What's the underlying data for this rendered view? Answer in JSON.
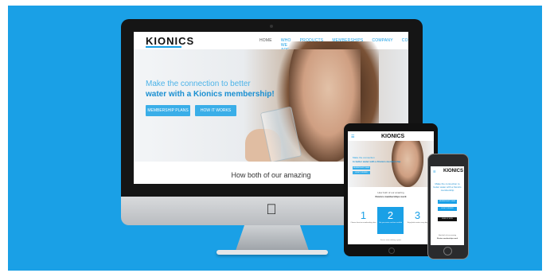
{
  "colors": {
    "background": "#1aa0e6",
    "accent": "#3aaee8",
    "headline_dark": "#1a8fd1"
  },
  "site": {
    "logo": "KIONICS",
    "nav": [
      "HOME",
      "WHO WE ARE",
      "PRODUCTS",
      "MEMBERSHIPS",
      "COMPANY",
      "CONTACT"
    ],
    "hero_line1": "Make the connection to better",
    "hero_line2": "water with a Kionics membership!",
    "btn_plans": "MEMBERSHIP PLANS",
    "btn_how": "HOW IT WORKS",
    "sub_heading": "How both of our amazing"
  },
  "tablet": {
    "logo": "KIONICS",
    "menu_icon": "hamburger-icon",
    "hero_line1": "Make the connection",
    "hero_line2": "to better water with a Kionics membership",
    "btn_plans": "MEMBERSHIP PLANS",
    "btn_how": "HOW IT WORKS",
    "sub1": "How both of our amazing",
    "sub2": "Kionics memberships work",
    "steps": [
      {
        "num": "1",
        "desc": "Choose from two membership plans"
      },
      {
        "num": "2",
        "desc": "Get your water machine installed"
      },
      {
        "num": "3",
        "desc": "Enjoy better water every day"
      }
    ],
    "footer": "Kionics water drinking system"
  },
  "phone": {
    "logo": "KIONICS",
    "menu_icon": "hamburger-icon",
    "hero": "Make the connection to better water with a Kionics membership",
    "btn1": "MEMBERSHIP PLANS",
    "btn2": "HOW IT WORKS",
    "btn3": "SIGN UP NOW",
    "sub1": "How both of our amazing",
    "sub2": "Kionics memberships work"
  }
}
